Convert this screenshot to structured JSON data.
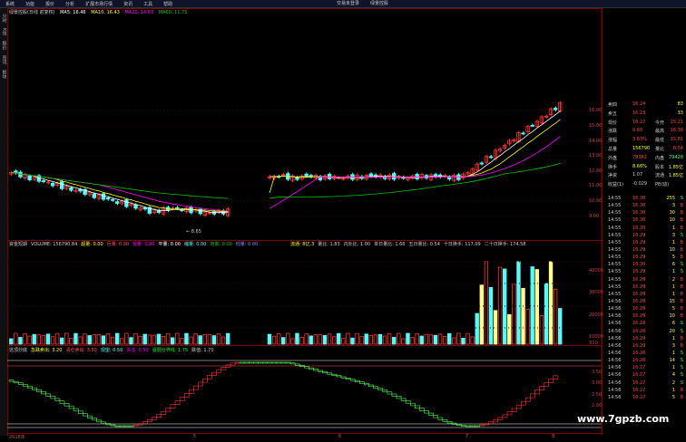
{
  "menu": {
    "items": [
      "系统",
      "功能",
      "报价",
      "分析",
      "扩展市场行情",
      "资讯",
      "工具",
      "帮助"
    ],
    "right_items": [
      "交易未登录",
      "绿景控股"
    ]
  },
  "sidebar": {
    "items": [
      "分时",
      "K线",
      "报价",
      "资讯",
      "板块"
    ]
  },
  "main_chart": {
    "title": "绿景控股(日线 前复权)",
    "ma5": "MA5: 16.46",
    "ma10": "MA10: 16.43",
    "ma20": "MA20: 14.83",
    "ma60": "MA60: 11.75",
    "low_label": "8.65",
    "y_labels": [
      "16.00",
      "15.00",
      "14.00",
      "13.00",
      "12.00",
      "11.00",
      "10.00",
      "9.00"
    ],
    "colors": {
      "up": "#ff3232",
      "down": "#54fcfc",
      "ma5": "#ffffff",
      "ma10": "#ffff00",
      "ma20": "#ff00ff",
      "ma60": "#00c000"
    }
  },
  "volume_panel": {
    "header": [
      "資金短期",
      "VOLUME: 156790.84",
      "超量: 0.00",
      "巨量: 0.00",
      "放量: 0.00",
      "平量: 0.00",
      "缩量: 0.00",
      "地量: 0.00",
      "低量: 0.00"
    ],
    "header2": [
      "流通: 8亿.3",
      "量比: 1.83",
      "内外比: 1.00",
      "单日量比: 1.66",
      "五日量比: 0.54",
      "十日换手: 117.09",
      "二十日换手: 174.58"
    ],
    "y_labels": [
      "40000",
      "30000",
      "20000",
      "10000",
      "X10"
    ]
  },
  "indicator_panel": {
    "header": [
      "逃顶抄底",
      "急跌卖出: 3.20",
      "清仓卖出: 3.50",
      "观望: 0.50",
      "关注: 0.50",
      "强弱分界线: 1.75",
      "跌值: 1.70"
    ],
    "y_labels": [
      "3.50",
      "3.00",
      "2.50",
      "2.00"
    ]
  },
  "time_axis": [
    "2018年",
    "5",
    "6",
    "7",
    "8"
  ],
  "quote": {
    "rows": [
      {
        "label": "卖四",
        "price": "16.24",
        "vol": "83"
      },
      {
        "label": "卖五",
        "price": "16.23",
        "vol": "33"
      },
      {
        "label": "现价",
        "price": "16.27",
        "extra_label": "今开",
        "extra": "15.21"
      },
      {
        "label": "涨跌",
        "price": "0.60",
        "extra_label": "最高",
        "extra": "16.39"
      },
      {
        "label": "涨幅",
        "price": "3.83%",
        "extra_label": "最低",
        "extra": "15.81"
      },
      {
        "label": "总量",
        "price": "156790",
        "extra_label": "量比",
        "extra": "0.54"
      },
      {
        "label": "外盘",
        "price": "79362",
        "extra_label": "内盘",
        "extra": "79428"
      },
      {
        "label": "换手",
        "price": "8.66%",
        "extra_label": "股本",
        "extra": "1.85亿"
      },
      {
        "label": "净资",
        "price": "1.07",
        "extra_label": "流通",
        "extra": "1.85亿"
      },
      {
        "label": "收益(1)",
        "price": "-0.029",
        "extra_label": "PE(动)",
        "extra": ""
      }
    ]
  },
  "ticks": [
    {
      "t": "14:55",
      "p": "16.30",
      "v": "255",
      "f": "S"
    },
    {
      "t": "14:55",
      "p": "16.30",
      "v": "3",
      "f": "B"
    },
    {
      "t": "14:55",
      "p": "16.30",
      "v": "30",
      "f": "B"
    },
    {
      "t": "14:55",
      "p": "16.30",
      "v": "10",
      "f": "B"
    },
    {
      "t": "14:55",
      "p": "16.30",
      "v": "1",
      "f": "B"
    },
    {
      "t": "14:55",
      "p": "16.29",
      "v": "3",
      "f": "S"
    },
    {
      "t": "14:55",
      "p": "16.29",
      "v": "1",
      "f": "B"
    },
    {
      "t": "14:55",
      "p": "16.29",
      "v": "10",
      "f": "B"
    },
    {
      "t": "14:55",
      "p": "16.29",
      "v": "5",
      "f": "B"
    },
    {
      "t": "14:55",
      "p": "16.30",
      "v": "6",
      "f": "S"
    },
    {
      "t": "14:55",
      "p": "16.29",
      "v": "1",
      "f": "S"
    },
    {
      "t": "14:55",
      "p": "16.29",
      "v": "2",
      "f": "B"
    },
    {
      "t": "14:55",
      "p": "16.29",
      "v": "1",
      "f": "B"
    },
    {
      "t": "14:55",
      "p": "16.29",
      "v": "1",
      "f": "B"
    },
    {
      "t": "14:56",
      "p": "16.29",
      "v": "15",
      "f": "B"
    },
    {
      "t": "14:56",
      "p": "16.29",
      "v": "5",
      "f": "B"
    },
    {
      "t": "14:56",
      "p": "16.29",
      "v": "10",
      "f": "B"
    },
    {
      "t": "14:56",
      "p": "16.28",
      "v": "6",
      "f": "S"
    },
    {
      "t": "14:56",
      "p": "16.28",
      "v": "20",
      "f": "S"
    },
    {
      "t": "14:56",
      "p": "16.29",
      "v": "1",
      "f": "B"
    },
    {
      "t": "14:56",
      "p": "16.29",
      "v": "3",
      "f": "B"
    },
    {
      "t": "14:56",
      "p": "16.28",
      "v": "1",
      "f": "S"
    },
    {
      "t": "14:56",
      "p": "16.28",
      "v": "14",
      "f": "S"
    },
    {
      "t": "14:56",
      "p": "16.27",
      "v": "1",
      "f": "S"
    },
    {
      "t": "14:56",
      "p": "16.27",
      "v": "4",
      "f": "S"
    },
    {
      "t": "14:56",
      "p": "16.27",
      "v": "2",
      "f": "S"
    },
    {
      "t": "14:56",
      "p": "16.27",
      "v": "1",
      "f": "B"
    },
    {
      "t": "14:56",
      "p": "16.27",
      "v": "5",
      "f": "B"
    }
  ],
  "watermark": "www.7gpzb.com"
}
